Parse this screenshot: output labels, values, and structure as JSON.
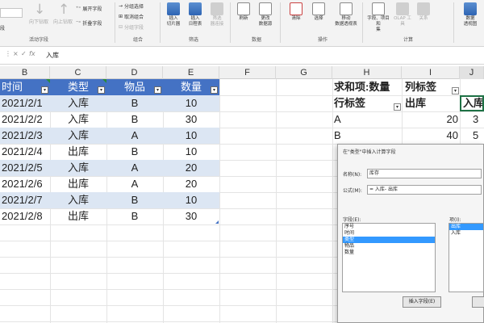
{
  "ribbon": {
    "left_partial_label": "段",
    "group_labels": [
      "活动字段",
      "组合",
      "筛选",
      "数据",
      "操作",
      "计算"
    ],
    "drill_down_label": "向下钻取",
    "drill_up_label": "向上钻取",
    "expand_field_label": "展开字段",
    "collapse_field_label": "折叠字段",
    "group_selection_label": "分组选择",
    "ungroup_label": "取消组合",
    "group_field_label": "分组字段",
    "insert_slicer_label": "插入\n切片器",
    "insert_timeline_label": "插入\n日程表",
    "filter_connections_label": "筛选\n器连接",
    "refresh_label": "刷新",
    "change_source_label": "更改\n数据源",
    "clear_label": "清除",
    "select_label": "选择",
    "move_pivot_label": "移动\n数据透视表",
    "fields_items_label": "字段、项目和\n集",
    "olap_tools_label": "OLAP 工具",
    "relationships_label": "关系",
    "pivotchart_label": "数据\n透视图"
  },
  "formula_bar": {
    "name_box_value": "",
    "fx_label": "fx",
    "cancel_symbol": "×",
    "enter_symbol": "✓",
    "value": "入库"
  },
  "columns": [
    "B",
    "C",
    "D",
    "E",
    "F",
    "G",
    "H",
    "I",
    "J"
  ],
  "table": {
    "headers": [
      "时间",
      "类型",
      "物品",
      "数量"
    ],
    "rows": [
      [
        "2021/2/1",
        "入库",
        "B",
        "10"
      ],
      [
        "2021/2/2",
        "入库",
        "B",
        "30"
      ],
      [
        "2021/2/3",
        "入库",
        "A",
        "10"
      ],
      [
        "2021/2/4",
        "出库",
        "B",
        "10"
      ],
      [
        "2021/2/5",
        "入库",
        "A",
        "20"
      ],
      [
        "2021/2/6",
        "出库",
        "A",
        "20"
      ],
      [
        "2021/2/7",
        "入库",
        "B",
        "10"
      ],
      [
        "2021/2/8",
        "出库",
        "B",
        "30"
      ]
    ]
  },
  "pivot": {
    "value_label": "求和项:数量",
    "col_label": "列标签",
    "row_label": "行标签",
    "col_out": "出库",
    "col_in": "入库",
    "rows": [
      {
        "label": "A",
        "out": "20",
        "in": "3"
      },
      {
        "label": "B",
        "out": "40",
        "in": "5"
      }
    ]
  },
  "dialog": {
    "title": "在\"类型\"中插入计算字段",
    "name_label": "名称(N):",
    "name_value": "库存",
    "formula_label": "公式(M):",
    "formula_value": "= 入库- 出库",
    "fields_label": "字段(E):",
    "fields": [
      "序号",
      "时间",
      "类型",
      "物品",
      "数量"
    ],
    "items_label": "项(I):",
    "items": [
      "出库",
      "入库"
    ],
    "insert_button": "插入字段(E)"
  }
}
